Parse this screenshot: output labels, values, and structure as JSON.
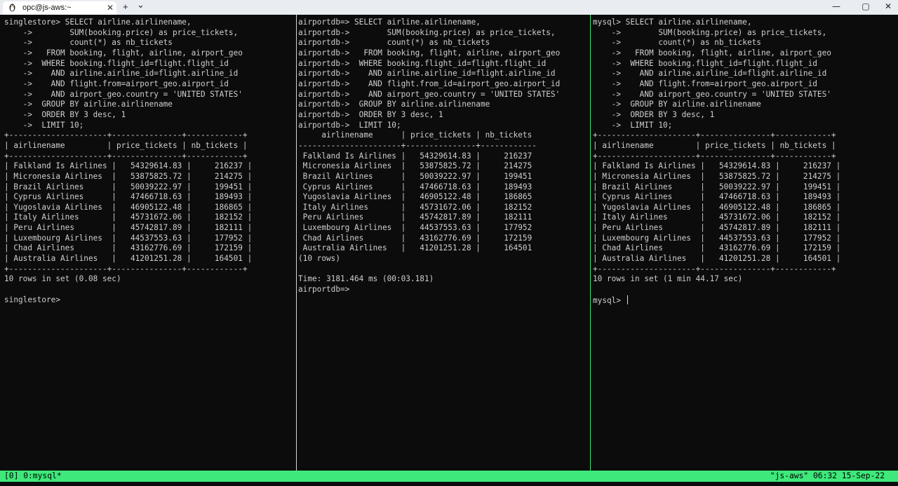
{
  "window": {
    "tab_title": "opc@js-aws:~",
    "tab_icon": "linux-penguin-icon",
    "new_tab": "+",
    "dropdown": "⌄",
    "close_tab": "✕",
    "minimize": "—",
    "maximize": "▢",
    "close": "✕"
  },
  "colors": {
    "status_bar": "#3ee87a",
    "divider_left": "#d7d7d7",
    "divider_right": "#3ee87a",
    "background": "#0c0c0c",
    "text": "#cfcfcf"
  },
  "panes": {
    "singlestore": {
      "text": "singlestore> SELECT airline.airlinename,\n    ->        SUM(booking.price) as price_tickets,\n    ->        count(*) as nb_tickets\n    ->   FROM booking, flight, airline, airport_geo\n    ->  WHERE booking.flight_id=flight.flight_id\n    ->    AND airline.airline_id=flight.airline_id\n    ->    AND flight.from=airport_geo.airport_id\n    ->    AND airport_geo.country = 'UNITED STATES'\n    ->  GROUP BY airline.airlinename\n    ->  ORDER BY 3 desc, 1\n    ->  LIMIT 10;\n+---------------------+---------------+------------+\n| airlinename         | price_tickets | nb_tickets |\n+---------------------+---------------+------------+\n| Falkland Is Airlines |   54329614.83 |     216237 |\n| Micronesia Airlines  |   53875825.72 |     214275 |\n| Brazil Airlines      |   50039222.97 |     199451 |\n| Cyprus Airlines      |   47466718.63 |     189493 |\n| Yugoslavia Airlines  |   46905122.48 |     186865 |\n| Italy Airlines       |   45731672.06 |     182152 |\n| Peru Airlines        |   45742817.89 |     182111 |\n| Luxembourg Airlines  |   44537553.63 |     177952 |\n| Chad Airlines        |   43162776.69 |     172159 |\n| Australia Airlines   |   41201251.28 |     164501 |\n+---------------------+---------------+------------+\n10 rows in set (0.08 sec)\n\nsinglestore>"
    },
    "airportdb": {
      "text": "airportdb=> SELECT airline.airlinename,\nairportdb->        SUM(booking.price) as price_tickets,\nairportdb->        count(*) as nb_tickets\nairportdb->   FROM booking, flight, airline, airport_geo\nairportdb->  WHERE booking.flight_id=flight.flight_id\nairportdb->    AND airline.airline_id=flight.airline_id\nairportdb->    AND flight.from_id=airport_geo.airport_id\nairportdb->    AND airport_geo.country = 'UNITED STATES'\nairportdb->  GROUP BY airline.airlinename\nairportdb->  ORDER BY 3 desc, 1\nairportdb->  LIMIT 10;\n     airlinename      | price_tickets | nb_tickets\n----------------------+---------------+------------\n Falkland Is Airlines |   54329614.83 |     216237\n Micronesia Airlines  |   53875825.72 |     214275\n Brazil Airlines      |   50039222.97 |     199451\n Cyprus Airlines      |   47466718.63 |     189493\n Yugoslavia Airlines  |   46905122.48 |     186865\n Italy Airlines       |   45731672.06 |     182152\n Peru Airlines        |   45742817.89 |     182111\n Luxembourg Airlines  |   44537553.63 |     177952\n Chad Airlines        |   43162776.69 |     172159\n Australia Airlines   |   41201251.28 |     164501\n(10 rows)\n\nTime: 3181.464 ms (00:03.181)\nairportdb=>"
    },
    "mysql": {
      "text": "mysql> SELECT airline.airlinename,\n    ->        SUM(booking.price) as price_tickets,\n    ->        count(*) as nb_tickets\n    ->   FROM booking, flight, airline, airport_geo\n    ->  WHERE booking.flight_id=flight.flight_id\n    ->    AND airline.airline_id=flight.airline_id\n    ->    AND flight.from=airport_geo.airport_id\n    ->    AND airport_geo.country = 'UNITED STATES'\n    ->  GROUP BY airline.airlinename\n    ->  ORDER BY 3 desc, 1\n    ->  LIMIT 10;\n+---------------------+---------------+------------+\n| airlinename         | price_tickets | nb_tickets |\n+---------------------+---------------+------------+\n| Falkland Is Airlines |   54329614.83 |     216237 |\n| Micronesia Airlines  |   53875825.72 |     214275 |\n| Brazil Airlines      |   50039222.97 |     199451 |\n| Cyprus Airlines      |   47466718.63 |     189493 |\n| Yugoslavia Airlines  |   46905122.48 |     186865 |\n| Italy Airlines       |   45731672.06 |     182152 |\n| Peru Airlines        |   45742817.89 |     182111 |\n| Luxembourg Airlines  |   44537553.63 |     177952 |\n| Chad Airlines        |   43162776.69 |     172159 |\n| Australia Airlines   |   41201251.28 |     164501 |\n+---------------------+---------------+------------+\n10 rows in set (1 min 44.17 sec)\n\nmysql>"
    }
  },
  "status_bar": {
    "left": "[0] 0:mysql*",
    "right": "\"js-aws\" 06:32 15-Sep-22"
  }
}
